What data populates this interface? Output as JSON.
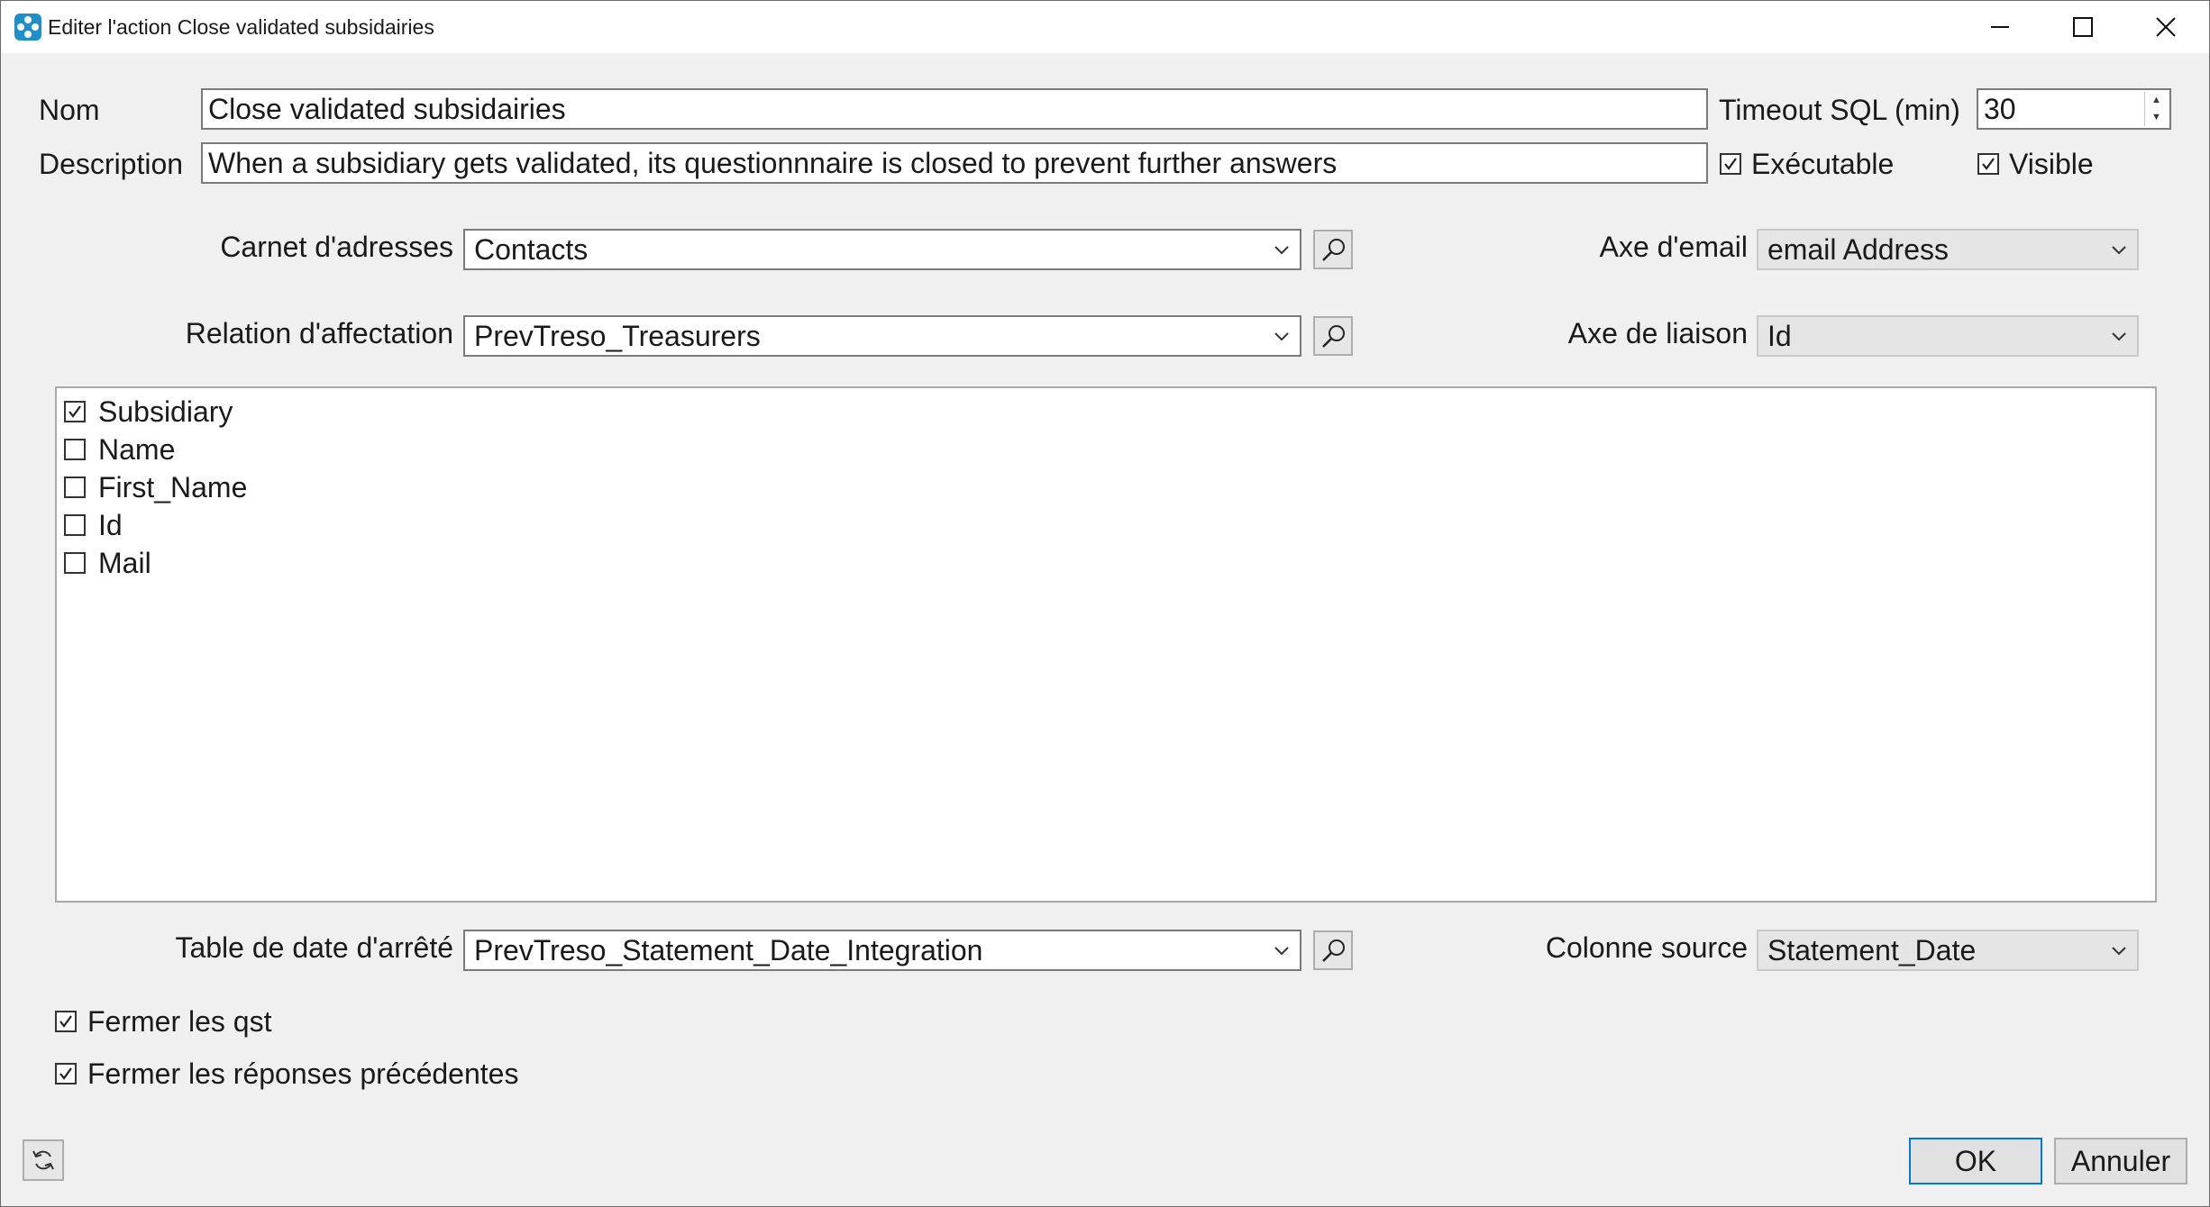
{
  "window": {
    "title": "Editer l'action Close validated subsidairies"
  },
  "form": {
    "nom_label": "Nom",
    "nom_value": "Close validated subsidairies",
    "description_label": "Description",
    "description_value": "When a subsidiary gets validated, its questionnnaire is closed to prevent further answers",
    "timeout_label": "Timeout SQL (min)",
    "timeout_value": "30",
    "executable_label": "Exécutable",
    "executable_checked": true,
    "visible_label": "Visible",
    "visible_checked": true,
    "carnet_label": "Carnet d'adresses",
    "carnet_value": "Contacts",
    "axe_email_label": "Axe d'email",
    "axe_email_value": "email Address",
    "relation_label": "Relation d'affectation",
    "relation_value": "PrevTreso_Treasurers",
    "axe_liaison_label": "Axe de liaison",
    "axe_liaison_value": "Id",
    "table_date_label": "Table de date d'arrêté",
    "table_date_value": "PrevTreso_Statement_Date_Integration",
    "colonne_source_label": "Colonne source",
    "colonne_source_value": "Statement_Date",
    "fermer_qst_label": "Fermer les qst",
    "fermer_qst_checked": true,
    "fermer_reponses_label": "Fermer les réponses précédentes",
    "fermer_reponses_checked": true
  },
  "fields_list": [
    {
      "label": "Subsidiary",
      "checked": true
    },
    {
      "label": "Name",
      "checked": false
    },
    {
      "label": "First_Name",
      "checked": false
    },
    {
      "label": "Id",
      "checked": false
    },
    {
      "label": "Mail",
      "checked": false
    }
  ],
  "buttons": {
    "ok": "OK",
    "cancel": "Annuler"
  },
  "icons": {
    "app": "app-icon",
    "minimize": "minimize-icon",
    "maximize": "maximize-icon",
    "close": "close-icon",
    "search": "magnifier-icon",
    "dropdown": "chevron-down-icon",
    "refresh": "refresh-icon"
  }
}
